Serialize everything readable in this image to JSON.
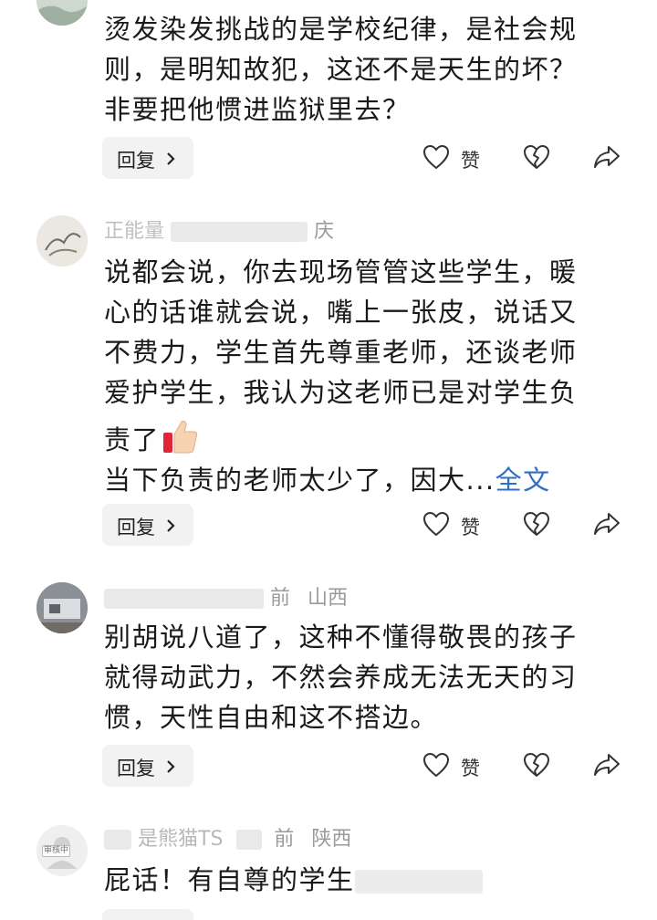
{
  "comments": [
    {
      "author": "",
      "time": "",
      "location": "",
      "lines": [
        "烫发染发挑战的是学校纪律，是社会规",
        "则，是明知故犯，这还不是天生的坏？",
        "非要把他惯进监狱里去？"
      ],
      "fulltext": "",
      "reply_label": "回复",
      "like_label": "赞"
    },
    {
      "author": "正能量",
      "time": "",
      "location": "庆",
      "lines": [
        "说都会说，你去现场管管这些学生，暖",
        "心的话谁就会说，嘴上一张皮，说话又",
        "不费力，学生首先尊重老师，还谈老师",
        "爱护学生，我认为这老师已是对学生负",
        "责了",
        "当下负责的老师太少了，因大..."
      ],
      "fulltext": "全文",
      "reply_label": "回复",
      "like_label": "赞"
    },
    {
      "author": "",
      "time": "前",
      "location": "山西",
      "lines": [
        "别胡说八道了，这种不懂得敬畏的孩子",
        "就得动武力，不然会养成无法无天的习",
        "惯，天性自由和这不搭边。"
      ],
      "fulltext": "",
      "reply_label": "回复",
      "like_label": "赞"
    },
    {
      "author": "是熊猫TS",
      "time": "前",
      "location": "陕西",
      "lines": [
        "屁话！有自尊的学生"
      ],
      "fulltext": "",
      "avatar_badge": "审核中",
      "reply_label": "",
      "like_label": ""
    }
  ],
  "icons": {
    "like": "heart-outline-icon",
    "dislike": "broken-heart-icon",
    "share": "share-arrow-icon",
    "reply_chevron": "chevron-right-icon",
    "emoji": "thumbs-up-emoji"
  },
  "colors": {
    "text": "#1a1a1a",
    "meta": "#9a9a9a",
    "link": "#2f6fc4",
    "reply_bg": "#f2f2f2"
  }
}
